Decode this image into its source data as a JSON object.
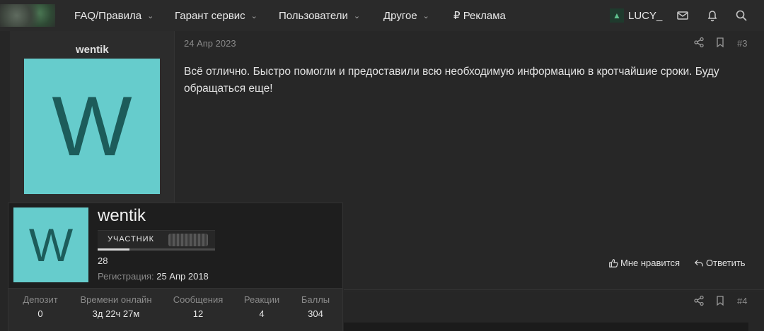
{
  "nav": {
    "items": [
      {
        "label": "FAQ/Правила",
        "dropdown": true
      },
      {
        "label": "Гарант сервис",
        "dropdown": true
      },
      {
        "label": "Пользователи",
        "dropdown": true
      },
      {
        "label": "Другое",
        "dropdown": true
      },
      {
        "label": "₽ Реклама",
        "dropdown": false
      }
    ],
    "username": "LUCY_"
  },
  "post": {
    "author": "wentik",
    "avatar_letter": "W",
    "date": "24 Апр 2023",
    "number": "#3",
    "body": "Всё отлично. Быстро помогли и предоставили всю необходимую информацию в кротчайшие сроки. Буду обращаться еще!",
    "like_label": "Мне нравится",
    "reply_label": "Ответить"
  },
  "tooltip": {
    "name": "wentik",
    "avatar_letter": "W",
    "badge": "УЧАСТНИК",
    "progress": 0.27,
    "messages": "28",
    "reg_label": "Регистрация:",
    "reg_date": "25 Апр 2018",
    "stats": [
      {
        "label": "Депозит",
        "value": "0"
      },
      {
        "label": "Времени онлайн",
        "value": "3д 22ч 27м"
      },
      {
        "label": "Сообщения",
        "value": "12"
      },
      {
        "label": "Реакции",
        "value": "4"
      },
      {
        "label": "Баллы",
        "value": "304"
      }
    ]
  },
  "post2": {
    "number": "#4"
  },
  "colors": {
    "avatar_bg": "#66cccc",
    "avatar_fg": "#1c5c5a",
    "background": "#262626"
  }
}
